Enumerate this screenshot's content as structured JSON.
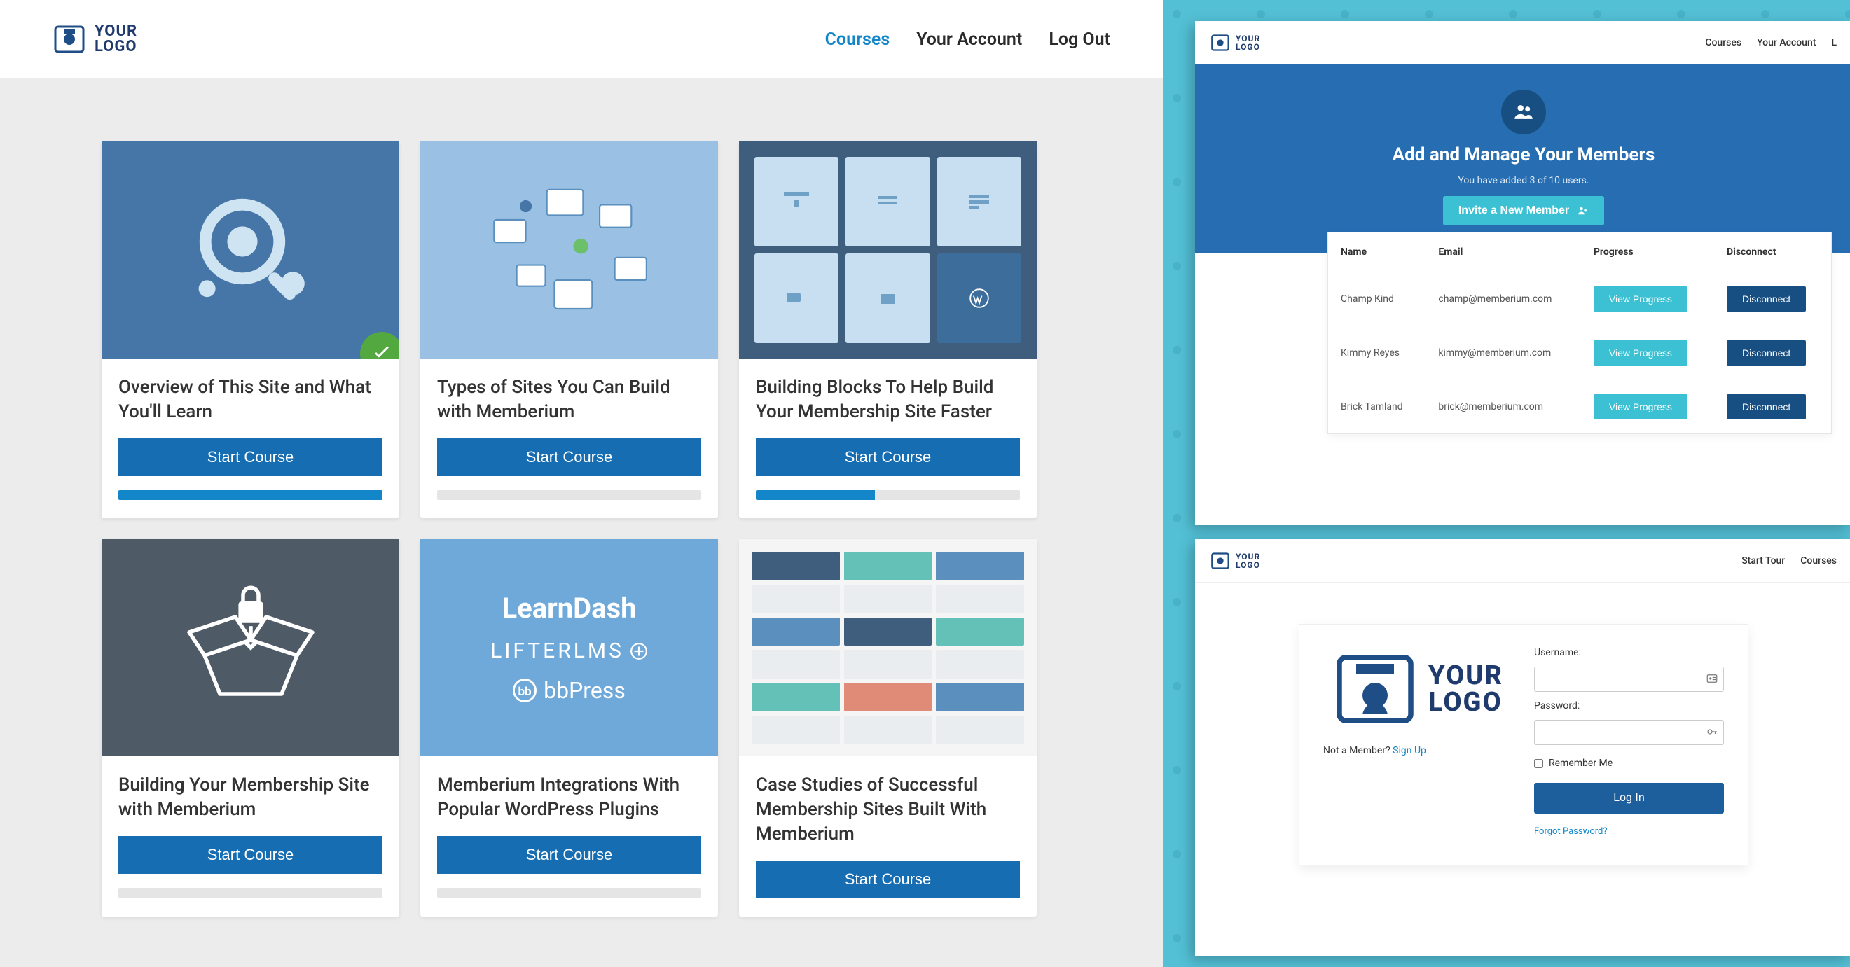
{
  "left": {
    "logo": {
      "line1": "YOUR",
      "line2": "LOGO"
    },
    "nav": {
      "courses": "Courses",
      "account": "Your Account",
      "logout": "Log Out"
    },
    "courses": [
      {
        "title": "Overview of This Site and What You'll Learn",
        "btn": "Start Course",
        "progress": 100,
        "complete": true,
        "thumb": "blue1"
      },
      {
        "title": "Types of Sites You Can Build with Memberium",
        "btn": "Start Course",
        "progress": 0,
        "complete": false,
        "thumb": "blue2"
      },
      {
        "title": "Building Blocks To Help Build Your Membership Site Faster",
        "btn": "Start Course",
        "progress": 45,
        "complete": false,
        "thumb": "blue3"
      },
      {
        "title": "Building Your Membership Site with Memberium",
        "btn": "Start Course",
        "progress": 0,
        "complete": false,
        "thumb": "gray"
      },
      {
        "title": "Memberium Integrations With Popular WordPress Plugins",
        "btn": "Start Course",
        "progress": 0,
        "complete": false,
        "thumb": "blue4"
      },
      {
        "title": "Case Studies of Successful Membership Sites Built With Memberium",
        "btn": "Start Course",
        "progress": 0,
        "complete": false,
        "thumb": "blue5"
      }
    ],
    "plugin_labels": {
      "learndash": "LearnDash",
      "lifterlms": "LIFTERLMS",
      "bbpress": "bbPress"
    }
  },
  "top_window": {
    "logo": {
      "line1": "YOUR",
      "line2": "LOGO"
    },
    "nav": {
      "courses": "Courses",
      "account": "Your Account",
      "logout_partial": "L"
    },
    "hero": {
      "title": "Add and Manage Your Members",
      "sub": "You have added 3 of 10 users.",
      "btn": "Invite a New Member"
    },
    "table": {
      "headers": {
        "name": "Name",
        "email": "Email",
        "progress": "Progress",
        "disconnect": "Disconnect"
      },
      "rows": [
        {
          "name": "Champ Kind",
          "email": "champ@memberium.com",
          "progress_btn": "View Progress",
          "disc_btn": "Disconnect"
        },
        {
          "name": "Kimmy Reyes",
          "email": "kimmy@memberium.com",
          "progress_btn": "View Progress",
          "disc_btn": "Disconnect"
        },
        {
          "name": "Brick Tamland",
          "email": "brick@memberium.com",
          "progress_btn": "View Progress",
          "disc_btn": "Disconnect"
        }
      ]
    }
  },
  "bottom_window": {
    "logo": {
      "line1": "YOUR",
      "line2": "LOGO"
    },
    "nav": {
      "start_tour": "Start Tour",
      "courses": "Courses"
    },
    "login": {
      "big_line1": "YOUR",
      "big_line2": "LOGO",
      "not_member_text": "Not a Member? ",
      "signup_link": "Sign Up",
      "username_label": "Username:",
      "password_label": "Password:",
      "remember": "Remember Me",
      "login_btn": "Log In",
      "forgot": "Forgot Password?"
    }
  }
}
